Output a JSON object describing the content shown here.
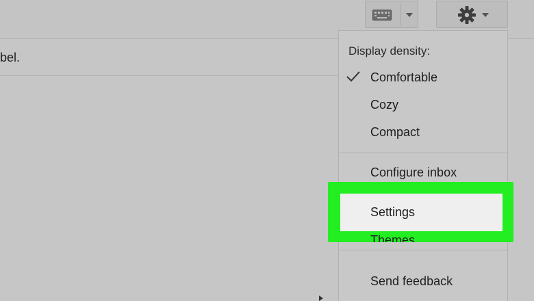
{
  "page": {
    "partial_label_text": "bel."
  },
  "toolbar": {
    "keyboard_icon": "keyboard-icon",
    "gear_icon": "gear-icon"
  },
  "menu": {
    "header": "Display density:",
    "density_options": [
      {
        "label": "Comfortable",
        "checked": true
      },
      {
        "label": "Cozy",
        "checked": false
      },
      {
        "label": "Compact",
        "checked": false
      }
    ],
    "configure_inbox": "Configure inbox",
    "settings": "Settings",
    "themes": "Themes",
    "send_feedback": "Send feedback"
  },
  "colors": {
    "highlight": "#22ee22",
    "background": "#c6c6c6"
  }
}
